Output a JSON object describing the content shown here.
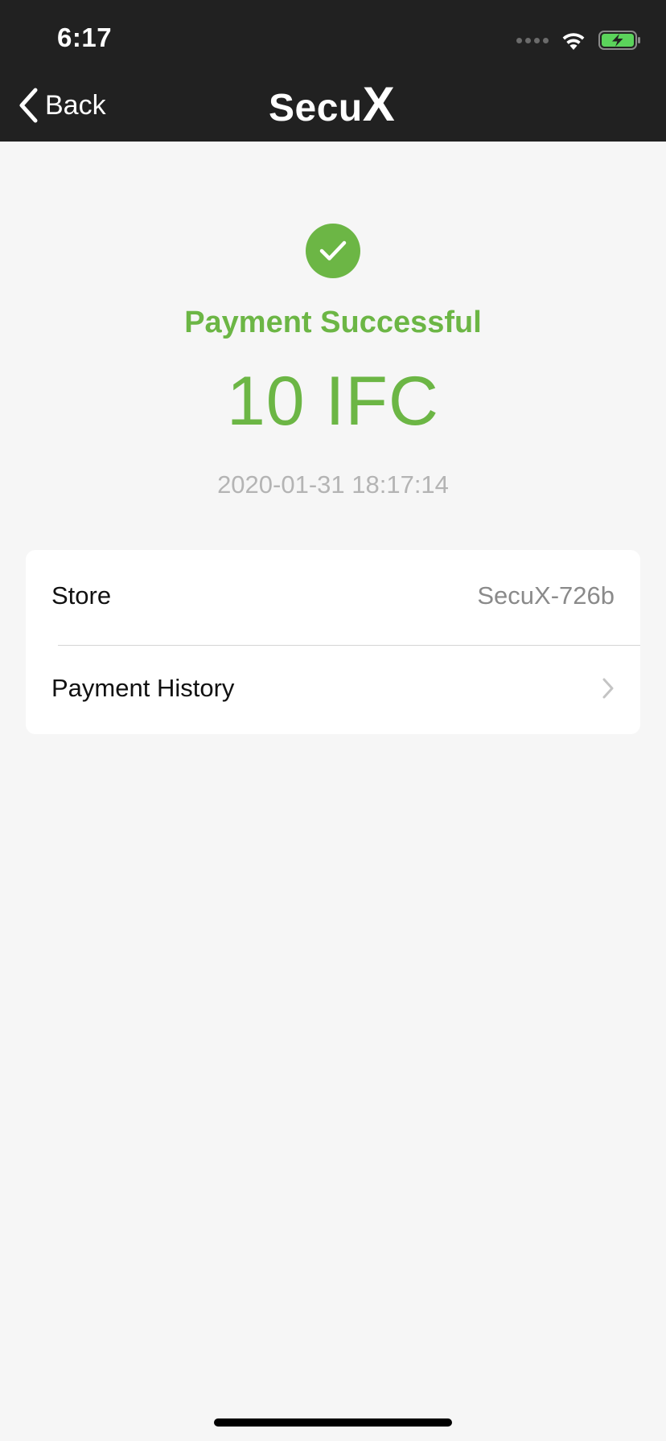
{
  "status_bar": {
    "time": "6:17"
  },
  "nav": {
    "back_label": "Back",
    "logo_text": "Secu",
    "logo_x": "X"
  },
  "payment": {
    "status": "Payment Successful",
    "amount": "10 IFC",
    "timestamp": "2020-01-31 18:17:14"
  },
  "details": {
    "store_label": "Store",
    "store_value": "SecuX-726b",
    "history_label": "Payment History"
  },
  "colors": {
    "header_bg": "#212121",
    "accent_green": "#6cb645",
    "page_bg": "#f6f6f6"
  }
}
